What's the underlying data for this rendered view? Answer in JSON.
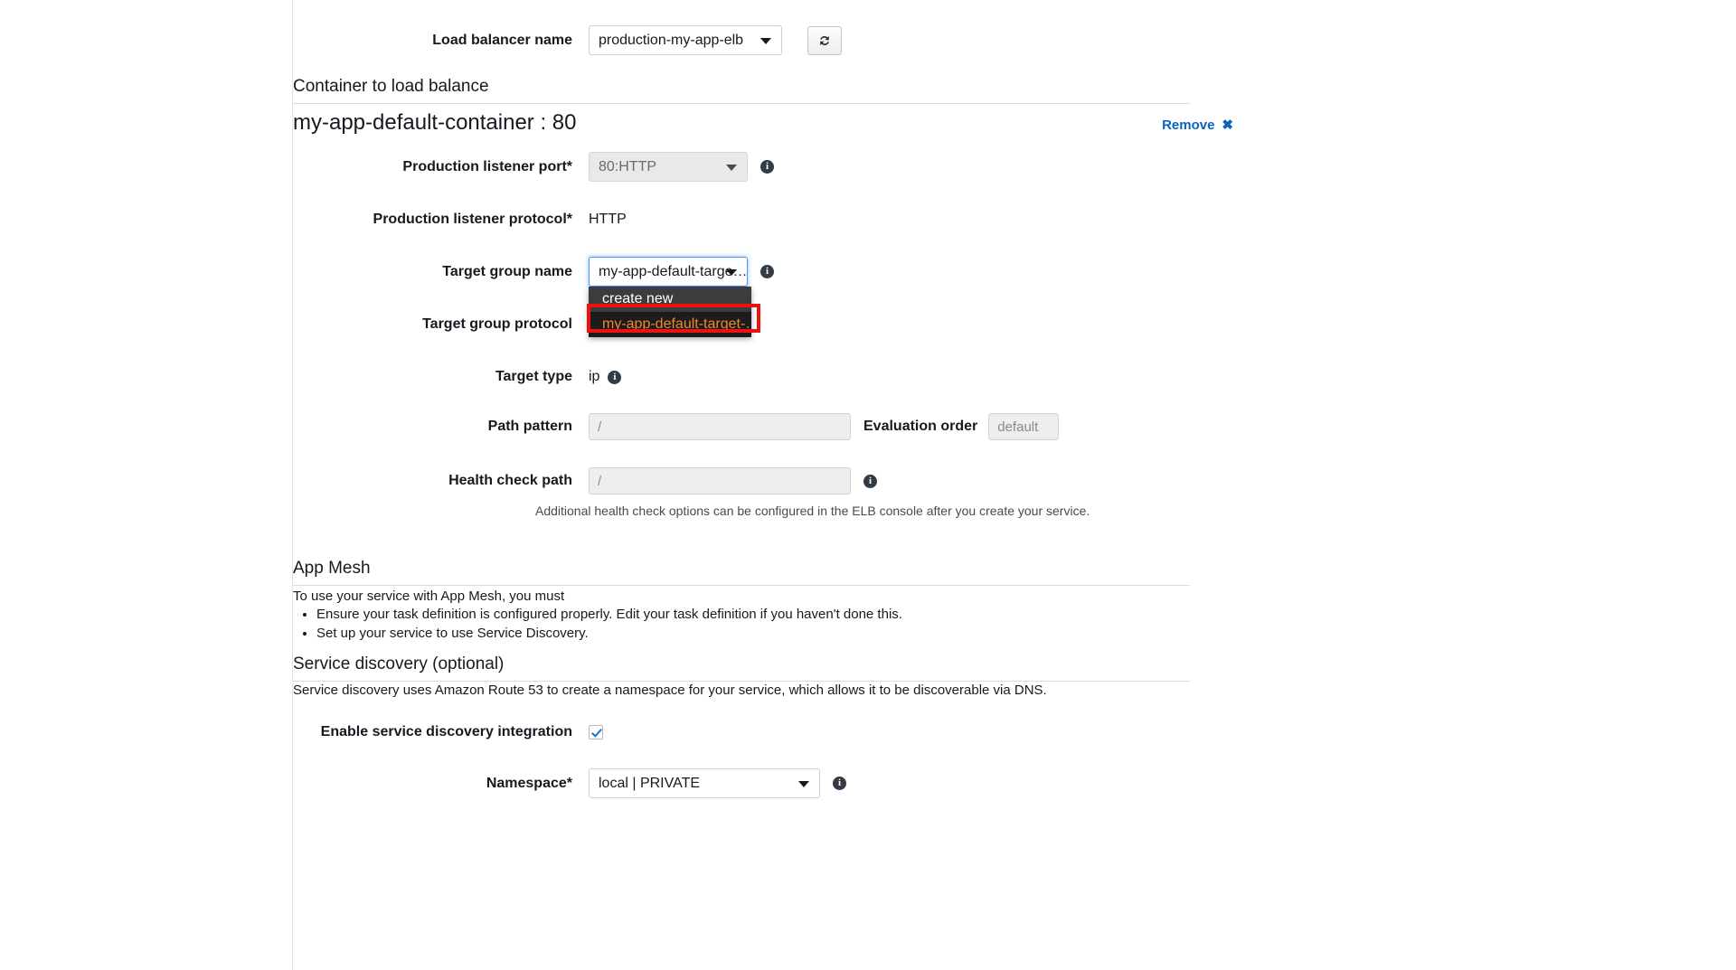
{
  "load_balancer": {
    "label": "Load balancer name",
    "value": "production-my-app-elb",
    "refresh_icon": "refresh-icon"
  },
  "container_section": {
    "heading": "Container to load balance",
    "title": "my-app-default-container : 80",
    "remove_label": "Remove",
    "remove_icon": "close-x-icon"
  },
  "listener_port": {
    "label": "Production listener port*",
    "value": "80:HTTP",
    "info_icon": "info-icon"
  },
  "listener_protocol": {
    "label": "Production listener protocol*",
    "value": "HTTP"
  },
  "target_group": {
    "label": "Target group name",
    "value": "my-app-default-targe…",
    "info_icon": "info-icon",
    "dropdown_open": true,
    "options": [
      {
        "label": "create new",
        "selected": false
      },
      {
        "label": "my-app-default-target-…",
        "selected": true
      }
    ]
  },
  "target_group_protocol": {
    "label": "Target group protocol"
  },
  "target_type": {
    "label": "Target type",
    "value": "ip",
    "info_icon": "info-icon"
  },
  "path_pattern": {
    "label": "Path pattern",
    "value": "/",
    "evaluation_order_label": "Evaluation order",
    "evaluation_order_value": "default"
  },
  "health_check": {
    "label": "Health check path",
    "value": "/",
    "info_icon": "info-icon",
    "hint": "Additional health check options can be configured in the ELB console after you create your service."
  },
  "app_mesh": {
    "heading": "App Mesh",
    "intro": "To use your service with App Mesh, you must",
    "bullets": [
      "Ensure your task definition is configured properly. Edit your task definition if you haven't done this.",
      "Set up your service to use Service Discovery."
    ]
  },
  "service_discovery": {
    "heading": "Service discovery (optional)",
    "description": "Service discovery uses Amazon Route 53 to create a namespace for your service, which allows it to be discoverable via DNS.",
    "enable_label": "Enable service discovery integration",
    "enable_checked": true,
    "namespace_label": "Namespace*",
    "namespace_value": "local | PRIVATE",
    "info_icon": "info-icon"
  },
  "colors": {
    "link_blue": "#0a63bd",
    "annotation_red": "#ee1111",
    "dropdown_selected_text": "#f08828",
    "dropdown_bg": "#3c3c3c",
    "dropdown_selected_bg": "#1c1c1c",
    "focus_blue": "#4d90fe",
    "checkbox_check": "#1a73c8"
  }
}
